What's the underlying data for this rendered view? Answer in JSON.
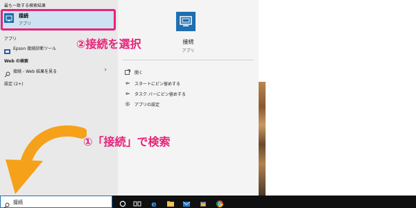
{
  "start_menu": {
    "best_match_heading": "最も一致する検索結果",
    "best_match": {
      "title": "接続",
      "subtitle": "アプリ"
    },
    "apps_heading": "アプリ",
    "apps": [
      {
        "label": "Epson 接続診断ツール"
      }
    ],
    "web_heading": "Web の検索",
    "web_result": "接続 - Web 結果を見る",
    "settings_heading": "設定 (2+)",
    "detail": {
      "title": "接続",
      "subtitle": "アプリ",
      "actions": [
        {
          "label": "開く",
          "icon": "open-icon"
        },
        {
          "label": "スタートにピン留めする",
          "icon": "pin-icon"
        },
        {
          "label": "タスク バーにピン留めする",
          "icon": "pin-icon"
        },
        {
          "label": "アプリの設定",
          "icon": "gear-icon"
        }
      ]
    }
  },
  "annotations": {
    "step2": "②接続を選択",
    "step1": "①「接続」で検索"
  },
  "taskbar": {
    "search_value": "接続",
    "icons": [
      "start-icon",
      "cortana-icon",
      "task-view-icon",
      "edge-icon",
      "explorer-icon",
      "mail-icon",
      "store-icon",
      "chrome-icon"
    ]
  },
  "colors": {
    "accent": "#1e6fb0",
    "annotation": "#e5247a",
    "arrow": "#f6a11a",
    "selection": "#cfe2f1"
  }
}
